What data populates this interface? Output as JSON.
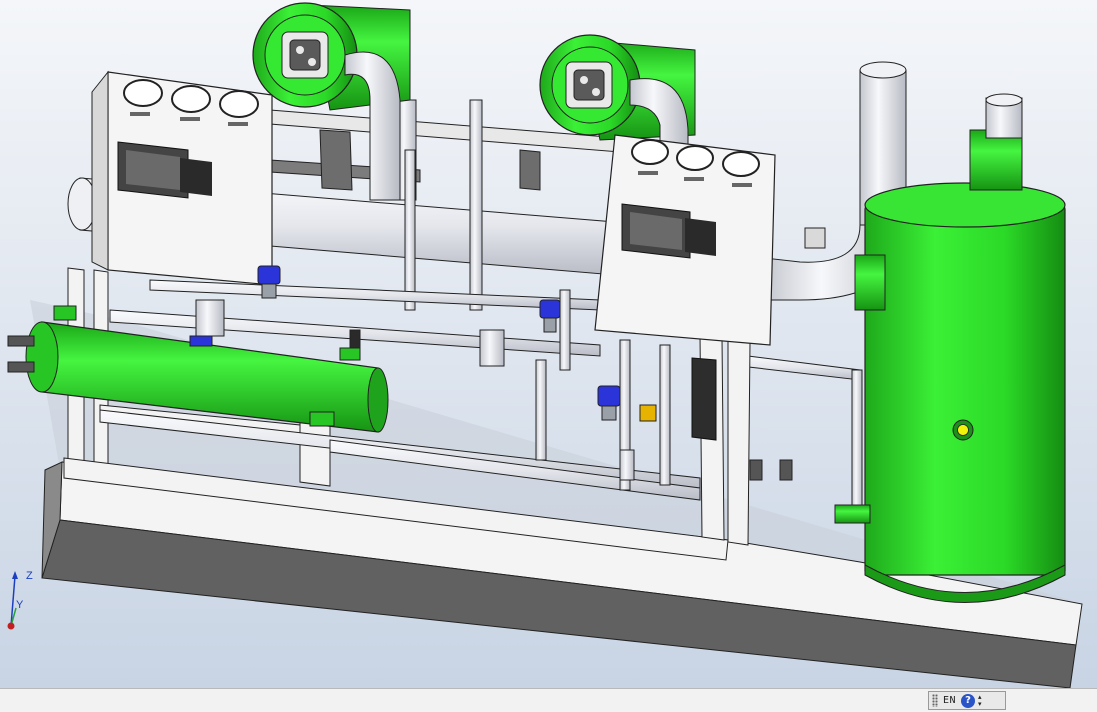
{
  "viewport": {
    "triad": {
      "z_label": "Z",
      "y_label": "Y"
    }
  },
  "taskbar": {
    "language": "EN",
    "help_label": "?",
    "arrow_up": "▴",
    "arrow_down": "▾"
  },
  "colors": {
    "equipment_green": "#2fdc2b",
    "frame_white": "#f3f3f3",
    "pipe_grey": "#e6e7ec",
    "base_dark": "#5e5e5e",
    "valve_blue": "#2a34d9",
    "sight_glass_yellow": "#f2f20a"
  }
}
